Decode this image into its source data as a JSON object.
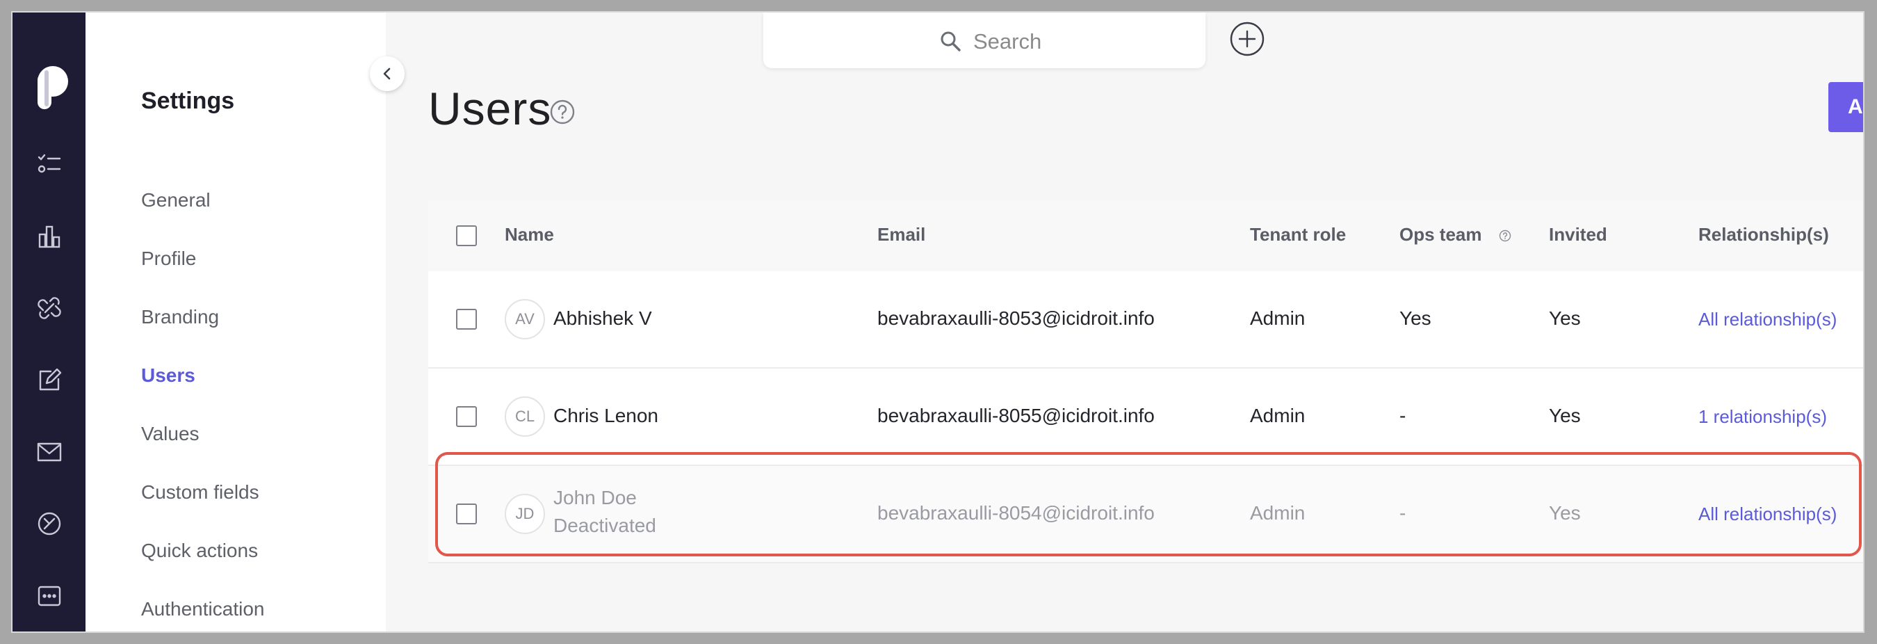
{
  "search": {
    "placeholder": "Search"
  },
  "settings": {
    "title": "Settings",
    "items": [
      {
        "label": "General",
        "active": false
      },
      {
        "label": "Profile",
        "active": false
      },
      {
        "label": "Branding",
        "active": false
      },
      {
        "label": "Users",
        "active": true
      },
      {
        "label": "Values",
        "active": false
      },
      {
        "label": "Custom fields",
        "active": false
      },
      {
        "label": "Quick actions",
        "active": false
      },
      {
        "label": "Authentication",
        "active": false
      }
    ]
  },
  "page": {
    "title": "Users",
    "primary_button_label": "A"
  },
  "table": {
    "columns": [
      "Name",
      "Email",
      "Tenant role",
      "Ops team",
      "Invited",
      "Relationship(s)"
    ],
    "rows": [
      {
        "initials": "AV",
        "name": "Abhishek V",
        "status": "",
        "email": "bevabraxaulli-8053@icidroit.info",
        "tenant_role": "Admin",
        "ops_team": "Yes",
        "invited": "Yes",
        "relationships": "All relationship(s)"
      },
      {
        "initials": "CL",
        "name": "Chris Lenon",
        "status": "",
        "email": "bevabraxaulli-8055@icidroit.info",
        "tenant_role": "Admin",
        "ops_team": "-",
        "invited": "Yes",
        "relationships": "1 relationship(s)"
      },
      {
        "initials": "JD",
        "name": "John Doe",
        "status": "Deactivated",
        "email": "bevabraxaulli-8054@icidroit.info",
        "tenant_role": "Admin",
        "ops_team": "-",
        "invited": "Yes",
        "relationships": "All relationship(s)"
      }
    ]
  },
  "colors": {
    "accent": "#5b5ad8",
    "rail": "#1e1b34",
    "highlight": "#e2574c",
    "primary_button": "#6c5ce7"
  },
  "icons": {
    "rail": [
      "logo-icon",
      "tasks-icon",
      "analytics-icon",
      "links-icon",
      "edit-icon",
      "mail-icon",
      "blocked-icon",
      "more-icon"
    ],
    "other": [
      "collapse-chevron-icon",
      "search-icon",
      "add-circle-icon",
      "help-icon"
    ]
  }
}
